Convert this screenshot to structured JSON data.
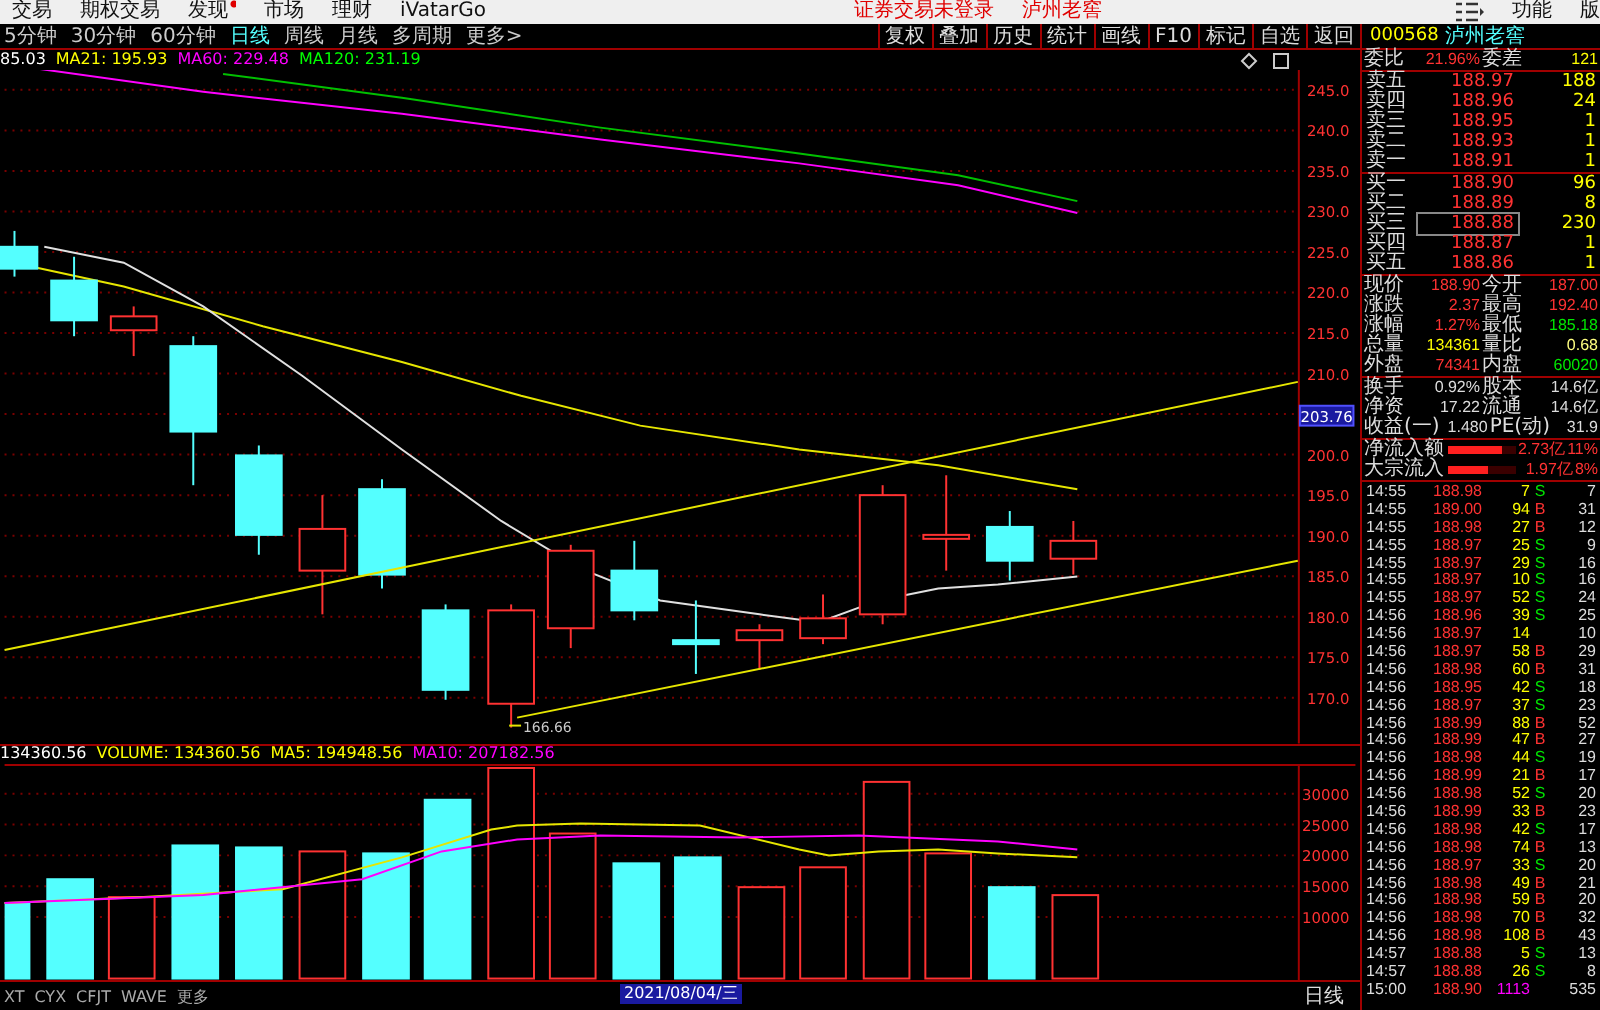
{
  "menu_bar": {
    "items": [
      {
        "label": "交易",
        "badge": false
      },
      {
        "label": "期权交易",
        "badge": false
      },
      {
        "label": "发现",
        "badge": true
      },
      {
        "label": "市场",
        "badge": false
      },
      {
        "label": "理财",
        "badge": false
      },
      {
        "label": "iVatarGo",
        "badge": false
      }
    ],
    "login_status": "证券交易未登录",
    "stock_name": "泸州老窖",
    "right_items": [
      "功能",
      "版"
    ]
  },
  "toolbar": {
    "periods": [
      {
        "label": "5分钟",
        "selected": false
      },
      {
        "label": "30分钟",
        "selected": false
      },
      {
        "label": "60分钟",
        "selected": false
      },
      {
        "label": "日线",
        "selected": true
      },
      {
        "label": "周线",
        "selected": false
      },
      {
        "label": "月线",
        "selected": false
      },
      {
        "label": "多周期",
        "selected": false
      },
      {
        "label": "更多>",
        "selected": false
      }
    ],
    "buttons": [
      "复权",
      "叠加",
      "历史",
      "统计",
      "画线",
      "F10",
      "标记",
      "自选",
      "返回"
    ]
  },
  "price_chart": {
    "legend": [
      {
        "text": "85.03",
        "color": "#ffffff"
      },
      {
        "text": "MA21: 195.93",
        "color": "#ffff00"
      },
      {
        "text": "MA60: 229.48",
        "color": "#ff00ff"
      },
      {
        "text": "MA120: 231.19",
        "color": "#00ff00"
      }
    ],
    "axis_upper": [
      "245.0",
      "240.0",
      "235.0",
      "230.0",
      "225.0",
      "220.0",
      "215.0",
      "210.0"
    ],
    "price_tag": "203.76",
    "axis_lower": [
      "200.0",
      "195.0",
      "190.0",
      "185.0",
      "180.0",
      "175.0",
      "170.0"
    ],
    "low_label": "166.66"
  },
  "volume_chart": {
    "legend": [
      {
        "text": "134360.56",
        "color": "#ffffff"
      },
      {
        "text": "VOLUME: 134360.56",
        "color": "#ffff00"
      },
      {
        "text": "MA5: 194948.56",
        "color": "#ffff00"
      },
      {
        "text": "MA10: 207182.56",
        "color": "#ff00ff"
      }
    ],
    "axis": [
      "30000",
      "25000",
      "20000",
      "15000",
      "10000"
    ]
  },
  "bottom_bar": {
    "tabs": [
      "XT",
      "CYX",
      "CFJT",
      "WAVE",
      "更多"
    ],
    "date_tag": "2021/08/04/三",
    "period_label": "日线"
  },
  "quote": {
    "code": "000568",
    "name": "泸州老窖",
    "ratio": {
      "label": "委比",
      "value": "21.96%",
      "label2": "委差",
      "value2": "121"
    },
    "asks": [
      {
        "label": "卖五",
        "price": "188.97",
        "volume": "188",
        "selected": false
      },
      {
        "label": "卖四",
        "price": "188.96",
        "volume": "24",
        "selected": false
      },
      {
        "label": "卖三",
        "price": "188.95",
        "volume": "1",
        "selected": false
      },
      {
        "label": "卖二",
        "price": "188.93",
        "volume": "1",
        "selected": false
      },
      {
        "label": "卖一",
        "price": "188.91",
        "volume": "1",
        "selected": false
      }
    ],
    "bids": [
      {
        "label": "买一",
        "price": "188.90",
        "volume": "96",
        "selected": false
      },
      {
        "label": "买二",
        "price": "188.89",
        "volume": "8",
        "selected": false
      },
      {
        "label": "买三",
        "price": "188.88",
        "volume": "230",
        "selected": true
      },
      {
        "label": "买四",
        "price": "188.87",
        "volume": "1",
        "selected": false
      },
      {
        "label": "买五",
        "price": "188.86",
        "volume": "1",
        "selected": false
      }
    ],
    "stats": [
      {
        "cells": [
          {
            "label": "现价",
            "value": "188.90",
            "color": "#ff3232"
          },
          {
            "label": "今开",
            "value": "187.00",
            "color": "#ff3232"
          }
        ]
      },
      {
        "cells": [
          {
            "label": "涨跌",
            "value": "2.37",
            "color": "#ff3232"
          },
          {
            "label": "最高",
            "value": "192.40",
            "color": "#ff3232"
          }
        ]
      },
      {
        "cells": [
          {
            "label": "涨幅",
            "value": "1.27%",
            "color": "#ff3232"
          },
          {
            "label": "最低",
            "value": "185.18",
            "color": "#00e600"
          }
        ]
      },
      {
        "cells": [
          {
            "label": "总量",
            "value": "134361",
            "color": "#ffff00"
          },
          {
            "label": "量比",
            "value": "0.68",
            "color": "#ffff80"
          }
        ]
      },
      {
        "cells": [
          {
            "label": "外盘",
            "value": "74341",
            "color": "#ff3232"
          },
          {
            "label": "内盘",
            "value": "60020",
            "color": "#00e600"
          }
        ]
      }
    ],
    "fundamentals": [
      {
        "label": "换手",
        "value": "0.92%",
        "label2": "股本",
        "value2": "14.6亿"
      },
      {
        "label": "净资",
        "value": "17.22",
        "label2": "流通",
        "value2": "14.6亿"
      },
      {
        "label": "收益(一)",
        "value": "1.480",
        "label2": "PE(动)",
        "value2": "31.9"
      }
    ],
    "flows": [
      {
        "label": "净流入额",
        "level": 0.8,
        "value": "2.73亿",
        "percent": "11%"
      },
      {
        "label": "大宗流入",
        "level": 0.58,
        "value": "1.97亿",
        "percent": "8%"
      }
    ]
  },
  "ticks": [
    {
      "time": "14:55",
      "price": "188.98",
      "volume": "7",
      "side": "S",
      "buy": false,
      "count": "7",
      "kind": "trade"
    },
    {
      "time": "14:55",
      "price": "189.00",
      "volume": "94",
      "side": "B",
      "buy": true,
      "count": "31",
      "kind": "trade"
    },
    {
      "time": "14:55",
      "price": "188.98",
      "volume": "27",
      "side": "B",
      "buy": true,
      "count": "12",
      "kind": "trade"
    },
    {
      "time": "14:55",
      "price": "188.97",
      "volume": "25",
      "side": "S",
      "buy": false,
      "count": "9",
      "kind": "trade"
    },
    {
      "time": "14:55",
      "price": "188.97",
      "volume": "29",
      "side": "S",
      "buy": false,
      "count": "16",
      "kind": "trade"
    },
    {
      "time": "14:55",
      "price": "188.97",
      "volume": "10",
      "side": "S",
      "buy": false,
      "count": "16",
      "kind": "trade"
    },
    {
      "time": "14:55",
      "price": "188.97",
      "volume": "52",
      "side": "S",
      "buy": false,
      "count": "24",
      "kind": "trade"
    },
    {
      "time": "14:56",
      "price": "188.96",
      "volume": "39",
      "side": "S",
      "buy": false,
      "count": "25",
      "kind": "trade"
    },
    {
      "time": "14:56",
      "price": "188.97",
      "volume": "14",
      "count": "10",
      "kind": "trade"
    },
    {
      "time": "14:56",
      "price": "188.97",
      "volume": "58",
      "side": "B",
      "buy": true,
      "count": "29",
      "kind": "trade"
    },
    {
      "time": "14:56",
      "price": "188.98",
      "volume": "60",
      "side": "B",
      "buy": true,
      "count": "31",
      "kind": "trade"
    },
    {
      "time": "14:56",
      "price": "188.95",
      "volume": "42",
      "side": "S",
      "buy": false,
      "count": "18",
      "kind": "trade"
    },
    {
      "time": "14:56",
      "price": "188.97",
      "volume": "37",
      "side": "S",
      "buy": false,
      "count": "23",
      "kind": "trade"
    },
    {
      "time": "14:56",
      "price": "188.99",
      "volume": "88",
      "side": "B",
      "buy": true,
      "count": "52",
      "kind": "trade"
    },
    {
      "time": "14:56",
      "price": "188.99",
      "volume": "47",
      "side": "B",
      "buy": true,
      "count": "27",
      "kind": "trade"
    },
    {
      "time": "14:56",
      "price": "188.98",
      "volume": "44",
      "side": "S",
      "buy": false,
      "count": "19",
      "kind": "trade"
    },
    {
      "time": "14:56",
      "price": "188.99",
      "volume": "21",
      "side": "B",
      "buy": true,
      "count": "17",
      "kind": "trade"
    },
    {
      "time": "14:56",
      "price": "188.98",
      "volume": "52",
      "side": "S",
      "buy": false,
      "count": "20",
      "kind": "trade"
    },
    {
      "time": "14:56",
      "price": "188.99",
      "volume": "33",
      "side": "B",
      "buy": true,
      "count": "23",
      "kind": "trade"
    },
    {
      "time": "14:56",
      "price": "188.98",
      "volume": "42",
      "side": "S",
      "buy": false,
      "count": "17",
      "kind": "trade"
    },
    {
      "time": "14:56",
      "price": "188.98",
      "volume": "74",
      "side": "B",
      "buy": true,
      "count": "13",
      "kind": "trade"
    },
    {
      "time": "14:56",
      "price": "188.97",
      "volume": "33",
      "side": "S",
      "buy": false,
      "count": "20",
      "kind": "trade"
    },
    {
      "time": "14:56",
      "price": "188.98",
      "volume": "49",
      "side": "B",
      "buy": true,
      "count": "21",
      "kind": "trade"
    },
    {
      "time": "14:56",
      "price": "188.98",
      "volume": "59",
      "side": "B",
      "buy": true,
      "count": "20",
      "kind": "trade"
    },
    {
      "time": "14:56",
      "price": "188.98",
      "volume": "70",
      "side": "B",
      "buy": true,
      "count": "32",
      "kind": "trade"
    },
    {
      "time": "14:56",
      "price": "188.98",
      "volume": "108",
      "side": "B",
      "buy": true,
      "count": "43",
      "kind": "trade"
    },
    {
      "time": "14:57",
      "price": "188.88",
      "volume": "5",
      "side": "S",
      "buy": false,
      "count": "13",
      "kind": "trade"
    },
    {
      "time": "14:57",
      "price": "188.88",
      "volume": "26",
      "side": "S",
      "buy": false,
      "count": "8",
      "kind": "trade"
    },
    {
      "time": "15:00",
      "price": "188.90",
      "volume": "1113",
      "count": "535",
      "kind": "auction"
    }
  ]
}
